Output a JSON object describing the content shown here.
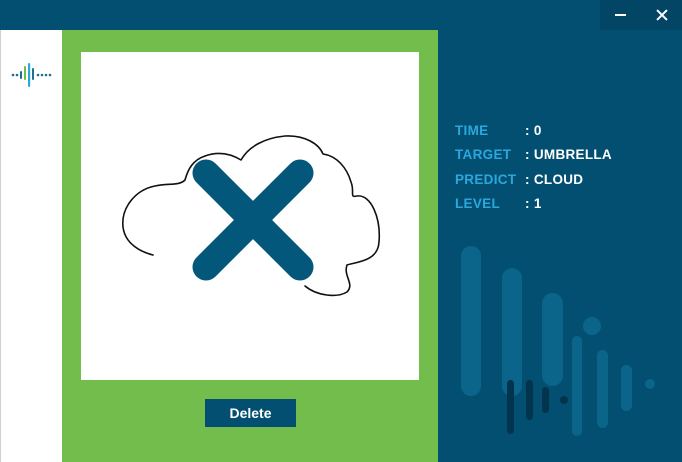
{
  "window": {
    "controls": {
      "minimize_icon": "minimize-icon",
      "close_icon": "close-icon"
    }
  },
  "sidebar": {
    "logo_icon": "sound-wave-icon"
  },
  "canvas": {
    "overlay_icon": "x-mark-icon",
    "delete_label": "Delete"
  },
  "stats": [
    {
      "label": "TIME",
      "value": ": 0"
    },
    {
      "label": "TARGET",
      "value": ": UMBRELLA"
    },
    {
      "label": "PREDICT",
      "value": ": CLOUD"
    },
    {
      "label": "LEVEL",
      "value": ": 1"
    }
  ],
  "colors": {
    "titlebar": "#034f72",
    "accent_green": "#72bd4c",
    "label_blue": "#2aa8dc",
    "panel_navy": "#034f72",
    "x_mark": "#03577b"
  }
}
